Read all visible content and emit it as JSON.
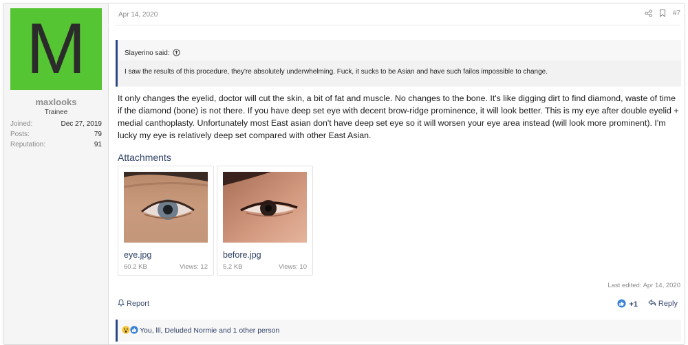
{
  "user": {
    "avatar_letter": "M",
    "avatar_color": "#56c534",
    "username": "maxlooks",
    "title": "Trainee",
    "stats": [
      {
        "label": "Joined:",
        "value": "Dec 27, 2019"
      },
      {
        "label": "Posts:",
        "value": "79"
      },
      {
        "label": "Reputation:",
        "value": "91"
      }
    ]
  },
  "post": {
    "date": "Apr 14, 2020",
    "number": "#7",
    "quote": {
      "author": "Slayerino said:",
      "text": "I saw the results of this procedure, they're absolutely underwhelming. Fuck, it sucks to be Asian and have such failos impossible to change."
    },
    "body": "It only changes the eyelid, doctor will cut the skin, a bit of fat and muscle. No changes to the bone. It's like digging dirt to find diamond, waste of time if the diamond (bone) is not there. If you have deep set eye with decent brow-ridge prominence, it will look better. This is my eye after double eyelid + medial canthoplasty. Unfortunately most East asian don't have deep set eye so it will worsen your eye area instead (will look more prominent). I'm lucky my eye is relatively deep set compared with other East Asian.",
    "attachments_title": "Attachments",
    "attachments": [
      {
        "name": "eye.jpg",
        "size": "60.2 KB",
        "views": "Views: 12"
      },
      {
        "name": "before.jpg",
        "size": "5.2 KB",
        "views": "Views: 10"
      }
    ],
    "last_edited": "Last edited: Apr 14, 2020",
    "actions": {
      "report": "Report",
      "like_count": "+1",
      "reply": "Reply"
    },
    "reactions_text": "You, lll, Deluded Normie and 1 other person"
  },
  "colors": {
    "accent": "#2b4686",
    "link": "#2d3f66"
  }
}
